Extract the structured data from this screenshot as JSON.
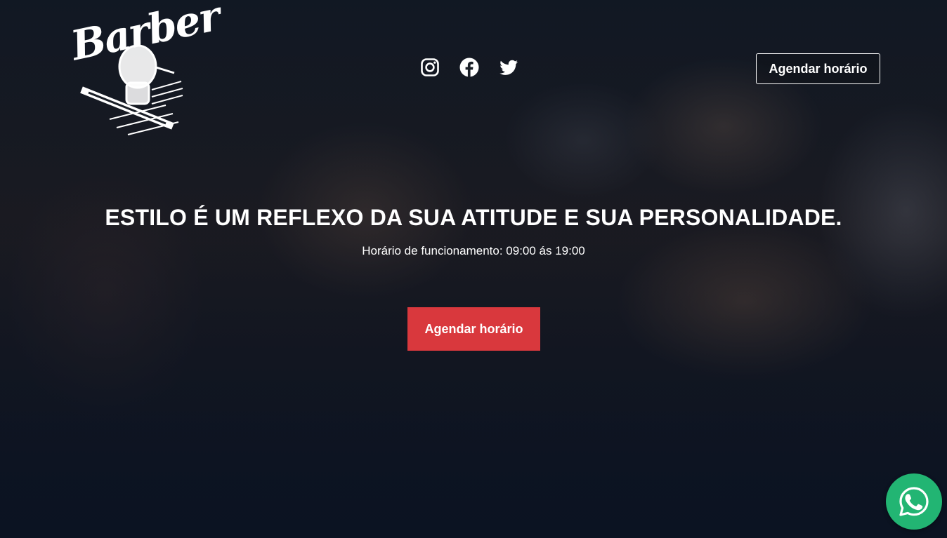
{
  "logo": {
    "text": "Barber"
  },
  "social": [
    {
      "name": "instagram-icon"
    },
    {
      "name": "facebook-icon"
    },
    {
      "name": "twitter-icon"
    }
  ],
  "header": {
    "cta_label": "Agendar horário"
  },
  "hero": {
    "headline": "ESTILO É UM REFLEXO DA SUA ATITUDE E SUA PERSONALIDADE.",
    "hours": "Horário de funcionamento: 09:00 ás 19:00",
    "cta_label": "Agendar horário"
  },
  "colors": {
    "accent": "#d9383d",
    "whatsapp": "#22b573",
    "text": "#ffffff"
  },
  "floating": {
    "icon": "whatsapp-icon"
  }
}
